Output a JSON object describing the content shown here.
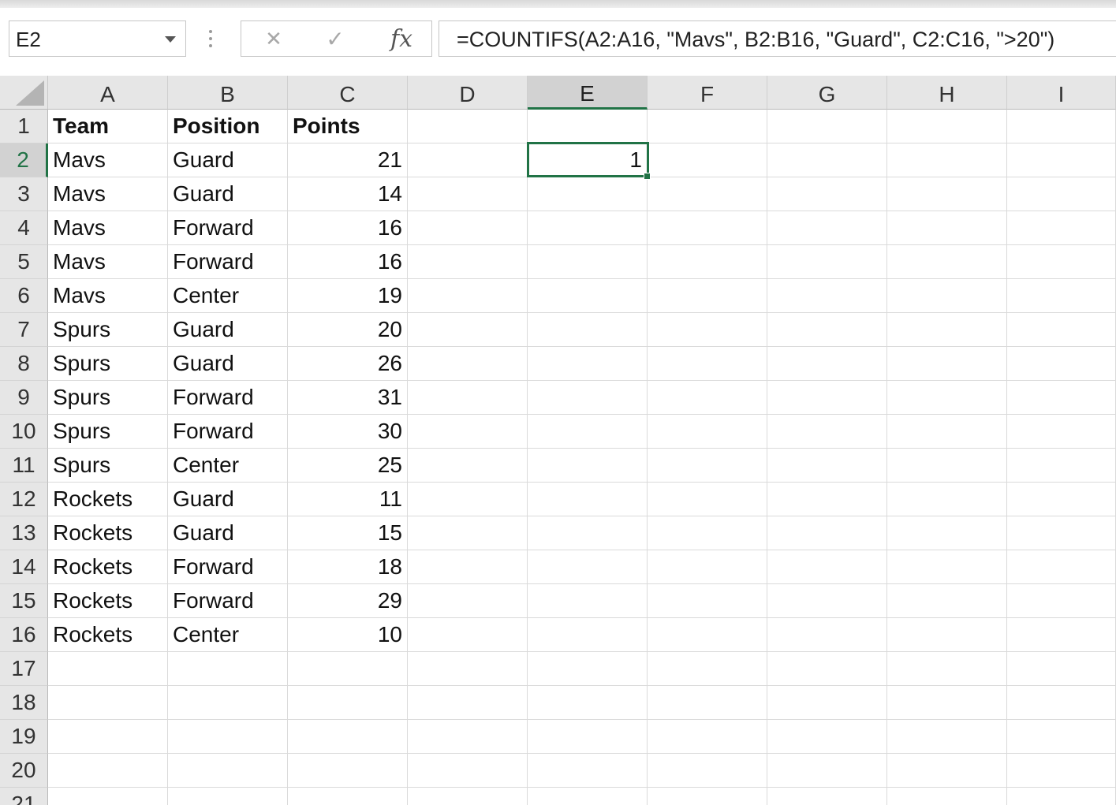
{
  "name_box": {
    "value": "E2"
  },
  "formula_bar": {
    "cancel_glyph": "✕",
    "enter_glyph": "✓",
    "fx_label": "fx",
    "formula": "=COUNTIFS(A2:A16, \"Mavs\", B2:B16, \"Guard\", C2:C16, \">20\")"
  },
  "columns": [
    "A",
    "B",
    "C",
    "D",
    "E",
    "F",
    "G",
    "H",
    "I"
  ],
  "selected_column": "E",
  "rows": [
    "1",
    "2",
    "3",
    "4",
    "5",
    "6",
    "7",
    "8",
    "9",
    "10",
    "11",
    "12",
    "13",
    "14",
    "15",
    "16",
    "17",
    "18",
    "19",
    "20",
    "21"
  ],
  "selected_row": "2",
  "header_row": [
    "Team",
    "Position",
    "Points"
  ],
  "data_rows": [
    [
      "Mavs",
      "Guard",
      "21"
    ],
    [
      "Mavs",
      "Guard",
      "14"
    ],
    [
      "Mavs",
      "Forward",
      "16"
    ],
    [
      "Mavs",
      "Forward",
      "16"
    ],
    [
      "Mavs",
      "Center",
      "19"
    ],
    [
      "Spurs",
      "Guard",
      "20"
    ],
    [
      "Spurs",
      "Guard",
      "26"
    ],
    [
      "Spurs",
      "Forward",
      "31"
    ],
    [
      "Spurs",
      "Forward",
      "30"
    ],
    [
      "Spurs",
      "Center",
      "25"
    ],
    [
      "Rockets",
      "Guard",
      "11"
    ],
    [
      "Rockets",
      "Guard",
      "15"
    ],
    [
      "Rockets",
      "Forward",
      "18"
    ],
    [
      "Rockets",
      "Forward",
      "29"
    ],
    [
      "Rockets",
      "Center",
      "10"
    ]
  ],
  "result_cell": {
    "ref": "E2",
    "value": "1"
  },
  "colors": {
    "selection": "#217346",
    "header_bg": "#e6e6e6",
    "gridline": "#dadada"
  }
}
